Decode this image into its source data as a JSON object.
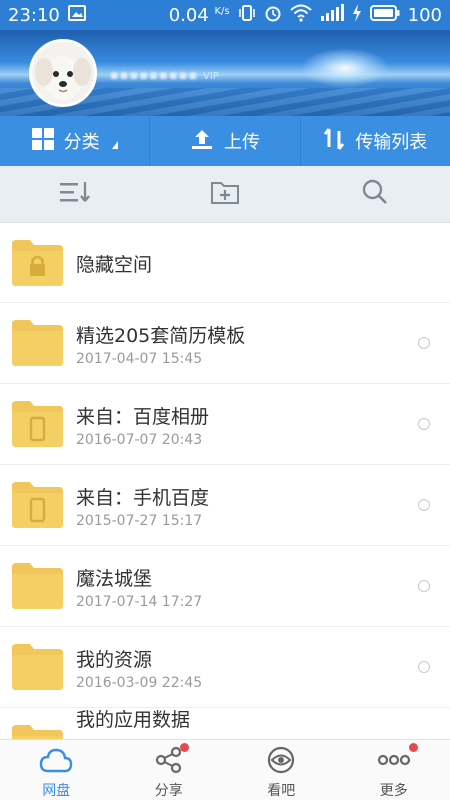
{
  "status_bar": {
    "time": "23:10",
    "speed": "0.04",
    "speed_unit": "K/s",
    "battery": "100"
  },
  "header": {
    "username": "▪▪▪▪▪▪▪▪▪",
    "vip_label": "VIP"
  },
  "actions": [
    {
      "label": "分类",
      "icon": "grid-icon"
    },
    {
      "label": "上传",
      "icon": "upload-icon"
    },
    {
      "label": "传输列表",
      "icon": "transfer-icon"
    }
  ],
  "toolbar": [
    {
      "icon": "sort-icon"
    },
    {
      "icon": "new-folder-icon"
    },
    {
      "icon": "search-icon"
    }
  ],
  "files": [
    {
      "name": "隐藏空间",
      "date": "",
      "type": "locked-folder"
    },
    {
      "name": "精选205套简历模板",
      "date": "2017-04-07  15:45",
      "type": "folder"
    },
    {
      "name": "来自：百度相册",
      "date": "2016-07-07  20:43",
      "type": "device-folder"
    },
    {
      "name": "来自：手机百度",
      "date": "2015-07-27  15:17",
      "type": "device-folder"
    },
    {
      "name": "魔法城堡",
      "date": "2017-07-14  17:27",
      "type": "folder"
    },
    {
      "name": "我的资源",
      "date": "2016-03-09  22:45",
      "type": "folder"
    },
    {
      "name": "我的应用数据",
      "date": "",
      "type": "folder"
    }
  ],
  "bottom_nav": [
    {
      "label": "网盘",
      "icon": "cloud-icon",
      "active": true
    },
    {
      "label": "分享",
      "icon": "share-icon",
      "badge": true
    },
    {
      "label": "看吧",
      "icon": "eye-icon"
    },
    {
      "label": "更多",
      "icon": "more-icon",
      "badge": true
    }
  ],
  "colors": {
    "primary": "#3b8fe2",
    "folder": "#f1c75b",
    "badge": "#e5484d"
  }
}
